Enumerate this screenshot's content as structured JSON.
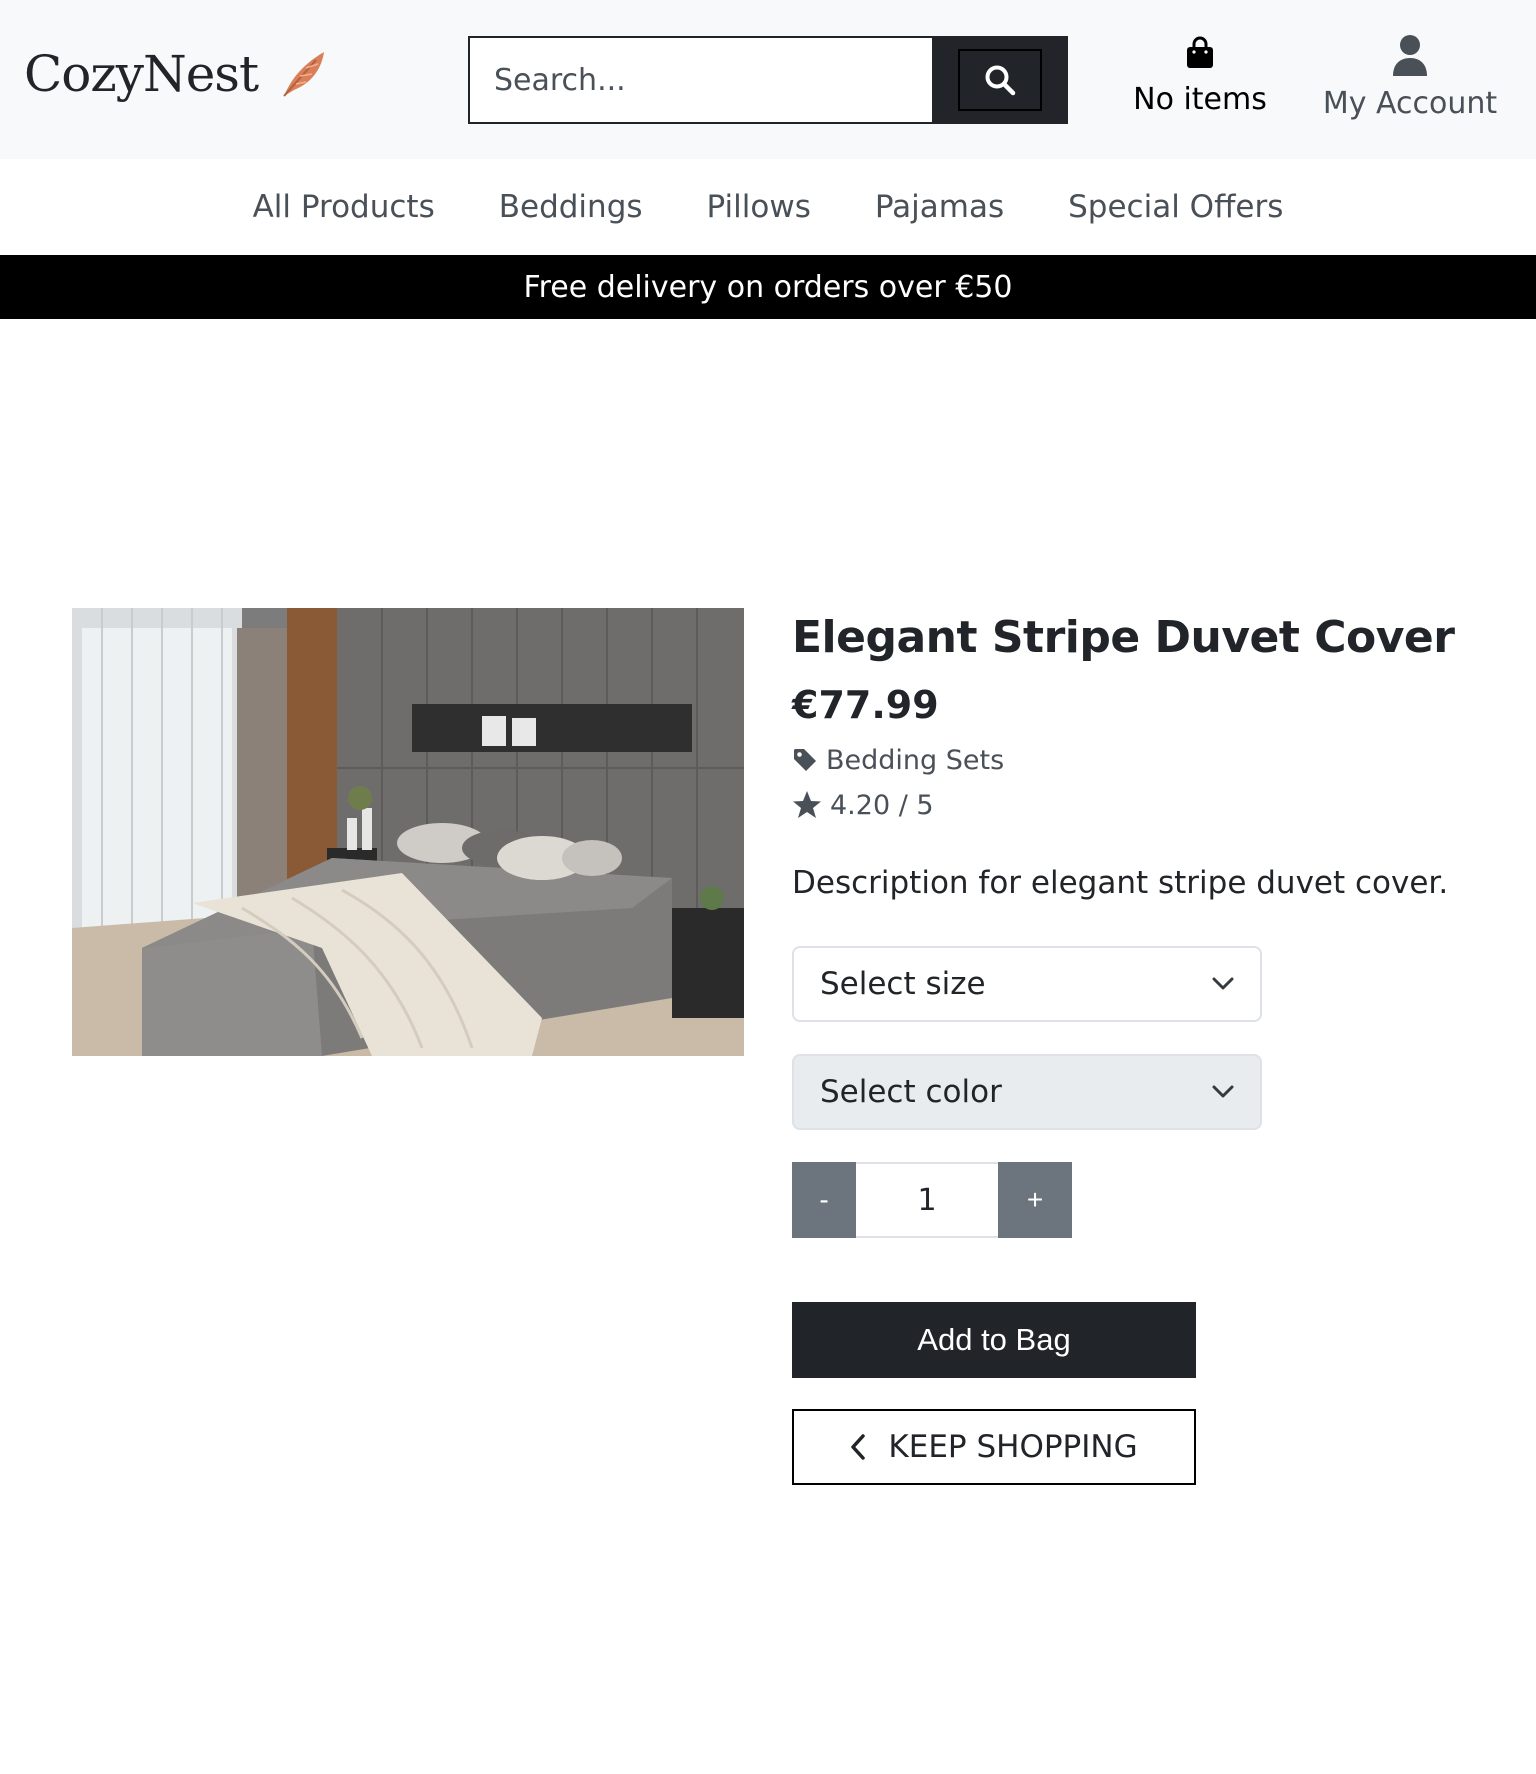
{
  "header": {
    "logo_text": "CozyNest",
    "search_placeholder": "Search...",
    "bag_label": "No items",
    "account_label": "My Account"
  },
  "nav": {
    "items": [
      "All Products",
      "Beddings",
      "Pillows",
      "Pajamas",
      "Special Offers"
    ]
  },
  "banner": {
    "text": "Free delivery on orders over €50"
  },
  "product": {
    "title": "Elegant Stripe Duvet Cover",
    "price": "€77.99",
    "category": "Bedding Sets",
    "rating": "4.20 / 5",
    "description": "Description for elegant stripe duvet cover.",
    "size_select": "Select size",
    "color_select": "Select color",
    "quantity": "1",
    "qty_minus": "-",
    "qty_plus": "+",
    "add_to_bag_label": "Add to Bag",
    "keep_shopping_label": "KEEP SHOPPING",
    "image_alt": "Bedroom with grey upholstered bed and cream knit throw"
  },
  "colors": {
    "header_bg": "#f8f9fa",
    "dark": "#212529",
    "banner_bg": "#000000",
    "muted_button": "#6c757d",
    "feather_accent": "#d9805a"
  },
  "icons": [
    "feather-icon",
    "search-icon",
    "shopping-bag-icon",
    "user-icon",
    "tag-icon",
    "star-icon",
    "chevron-down-icon",
    "chevron-left-icon"
  ]
}
